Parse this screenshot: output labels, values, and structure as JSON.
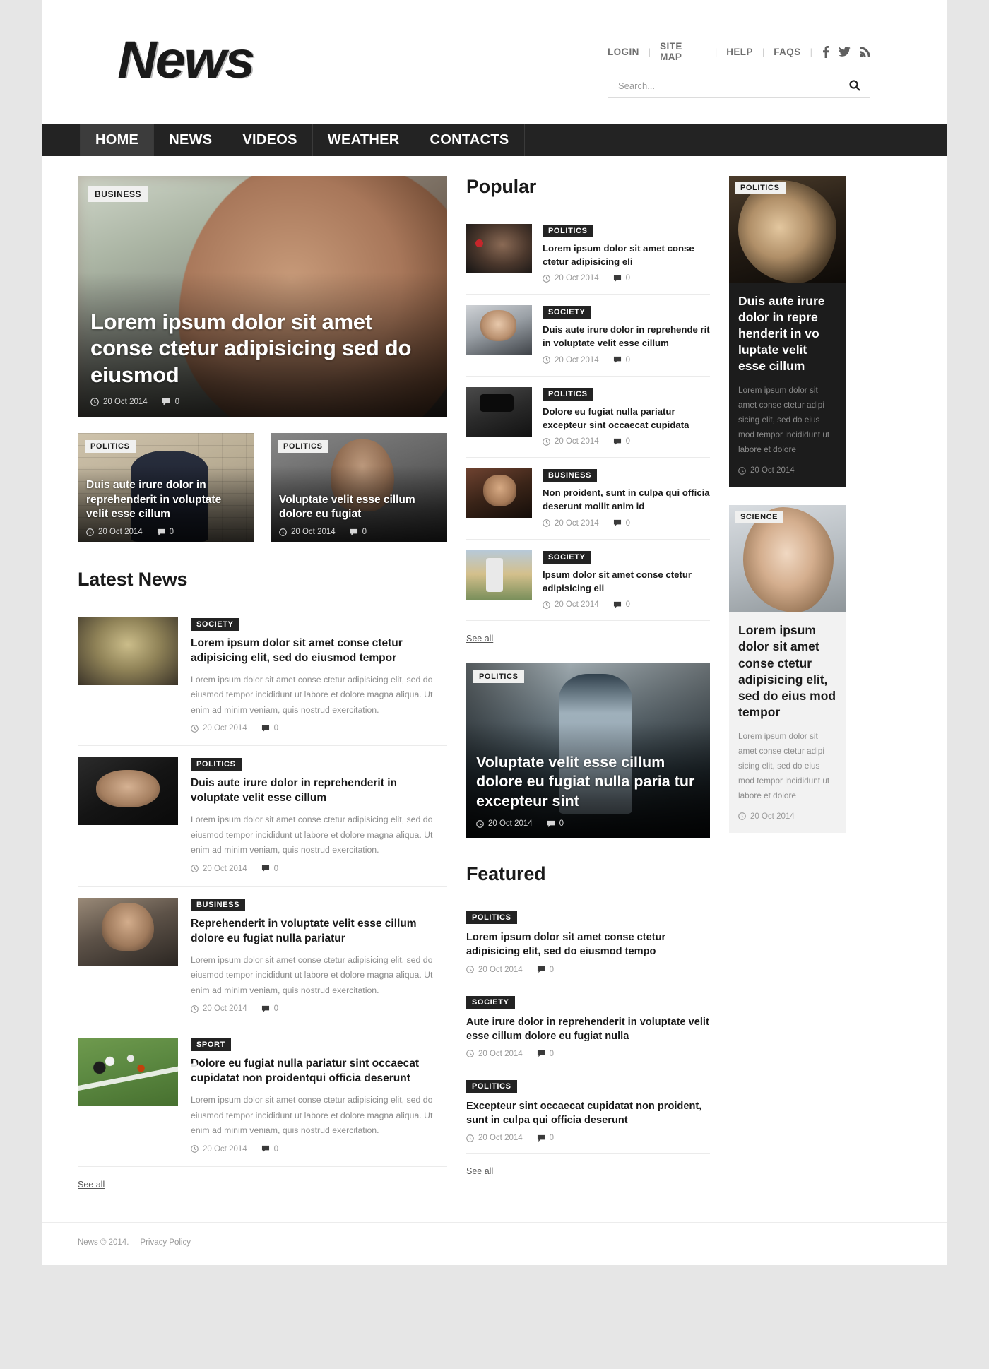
{
  "site": {
    "logo": "News",
    "footer_copyright": "News © 2014.",
    "footer_privacy": "Privacy Policy"
  },
  "topbar": {
    "links": [
      "LOGIN",
      "SITE MAP",
      "HELP",
      "FAQS"
    ],
    "separator": "|",
    "social": [
      "facebook-icon",
      "twitter-icon",
      "rss-icon"
    ]
  },
  "search": {
    "placeholder": "Search...",
    "value": "",
    "button_icon": "search-icon"
  },
  "nav": {
    "items": [
      {
        "label": "HOME",
        "active": true
      },
      {
        "label": "NEWS",
        "active": false
      },
      {
        "label": "VIDEOS",
        "active": false
      },
      {
        "label": "WEATHER",
        "active": false
      },
      {
        "label": "CONTACTS",
        "active": false
      }
    ]
  },
  "hero": {
    "category": "BUSINESS",
    "title": "Lorem ipsum dolor sit amet conse ctetur adipisicing sed do eiusmod",
    "date": "20 Oct 2014",
    "comments": "0"
  },
  "duo": [
    {
      "category": "POLITICS",
      "title": "Duis aute irure dolor in reprehenderit in voluptate velit esse cillum",
      "date": "20 Oct 2014",
      "comments": "0"
    },
    {
      "category": "POLITICS",
      "title": "Voluptate velit esse cillum dolore eu fugiat",
      "date": "20 Oct 2014",
      "comments": "0"
    }
  ],
  "latest": {
    "title": "Latest News",
    "see_all": "See all",
    "items": [
      {
        "category": "SOCIETY",
        "title": "Lorem ipsum dolor sit amet conse ctetur adipisicing elit, sed do eiusmod tempor",
        "excerpt": "Lorem ipsum dolor sit amet conse ctetur adipisicing elit, sed do eiusmod tempor incididunt ut labore et dolore magna aliqua. Ut enim ad minim veniam, quis nostrud exercitation.",
        "date": "20 Oct 2014",
        "comments": "0"
      },
      {
        "category": "POLITICS",
        "title": "Duis aute irure dolor in reprehenderit in voluptate velit esse cillum",
        "excerpt": "Lorem ipsum dolor sit amet conse ctetur adipisicing elit, sed do eiusmod tempor incididunt ut labore et dolore magna aliqua. Ut enim ad minim veniam, quis nostrud exercitation.",
        "date": "20 Oct 2014",
        "comments": "0"
      },
      {
        "category": "BUSINESS",
        "title": "Reprehenderit in voluptate velit esse cillum dolore eu fugiat nulla pariatur",
        "excerpt": "Lorem ipsum dolor sit amet conse ctetur adipisicing elit, sed do eiusmod tempor incididunt ut labore et dolore magna aliqua. Ut enim ad minim veniam, quis nostrud exercitation.",
        "date": "20 Oct 2014",
        "comments": "0"
      },
      {
        "category": "SPORT",
        "title": "Dolore eu fugiat nulla pariatur sint occaecat cupidatat non proidentqui officia deserunt",
        "excerpt": "Lorem ipsum dolor sit amet conse ctetur adipisicing elit, sed do eiusmod tempor incididunt ut labore et dolore magna aliqua. Ut enim ad minim veniam, quis nostrud exercitation.",
        "date": "20 Oct 2014",
        "comments": "0"
      }
    ]
  },
  "popular": {
    "title": "Popular",
    "see_all": "See all",
    "items": [
      {
        "category": "POLITICS",
        "title": "Lorem ipsum dolor sit amet conse ctetur adipisicing eli",
        "date": "20 Oct 2014",
        "comments": "0"
      },
      {
        "category": "SOCIETY",
        "title": "Duis aute irure dolor in reprehende rit in voluptate velit esse cillum",
        "date": "20 Oct 2014",
        "comments": "0"
      },
      {
        "category": "POLITICS",
        "title": "Dolore eu fugiat nulla pariatur excepteur sint occaecat cupidata",
        "date": "20 Oct 2014",
        "comments": "0"
      },
      {
        "category": "BUSINESS",
        "title": "Non proident, sunt in culpa qui officia deserunt mollit anim id",
        "date": "20 Oct 2014",
        "comments": "0"
      },
      {
        "category": "SOCIETY",
        "title": "Ipsum dolor sit amet conse ctetur adipisicing eli",
        "date": "20 Oct 2014",
        "comments": "0"
      }
    ]
  },
  "banner": {
    "category": "POLITICS",
    "title": "Voluptate velit esse cillum dolore eu fugiat nulla paria tur excepteur sint",
    "date": "20 Oct 2014",
    "comments": "0"
  },
  "featured": {
    "title": "Featured",
    "see_all": "See all",
    "items": [
      {
        "category": "POLITICS",
        "title": "Lorem ipsum dolor sit amet conse ctetur adipisicing elit, sed do eiusmod tempo",
        "date": "20 Oct 2014",
        "comments": "0"
      },
      {
        "category": "SOCIETY",
        "title": "Aute irure dolor in reprehenderit in voluptate velit esse cillum dolore eu fugiat nulla",
        "date": "20 Oct 2014",
        "comments": "0"
      },
      {
        "category": "POLITICS",
        "title": "Excepteur sint occaecat cupidatat non proident, sunt in culpa qui officia deserunt",
        "date": "20 Oct 2014",
        "comments": "0"
      }
    ]
  },
  "sidebar": {
    "cards": [
      {
        "category": "POLITICS",
        "title": "Duis aute irure dolor in repre henderit in vo luptate velit esse cillum",
        "excerpt": "Lorem ipsum dolor sit amet conse ctetur adipi sicing elit, sed do eius mod tempor incididunt ut labore et dolore",
        "date": "20 Oct 2014"
      },
      {
        "category": "SCIENCE",
        "title": "Lorem ipsum dolor sit amet conse ctetur adipisicing elit, sed do eius mod tempor",
        "excerpt": "Lorem ipsum dolor sit amet conse ctetur adipi sicing elit, sed do eius mod tempor incididunt ut labore et dolore",
        "date": "20 Oct 2014"
      }
    ]
  },
  "colors": {
    "badge_dark": "#232323",
    "badge_light": "#f0f0ef",
    "nav_bg": "#232323",
    "nav_active": "#3c3c3c",
    "page_bg": "#e6e6e6",
    "text": "#1a1a1a",
    "muted": "#8d8d8d"
  }
}
